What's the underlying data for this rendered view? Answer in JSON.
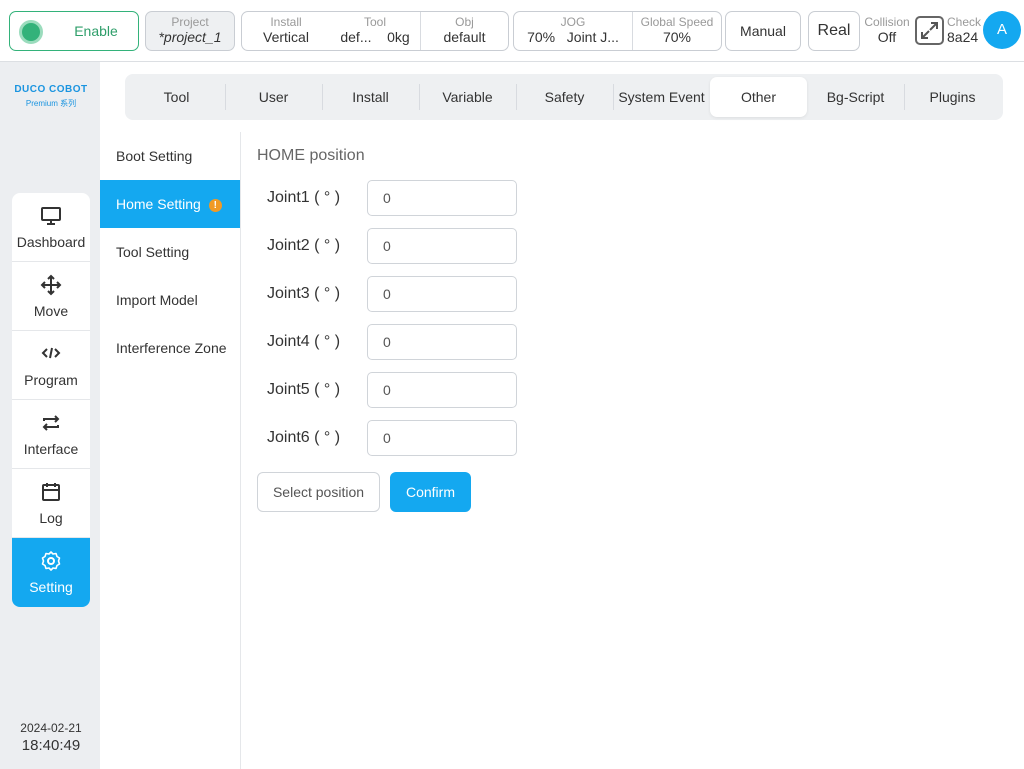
{
  "topbar": {
    "enable_label": "Enable",
    "project": {
      "label": "Project",
      "value": "*project_1"
    },
    "install": {
      "label": "Install",
      "value": "Vertical"
    },
    "tool": {
      "label": "Tool",
      "value_name": "def...",
      "value_load": "0kg"
    },
    "obj": {
      "label": "Obj",
      "value": "default"
    },
    "jog": {
      "label": "JOG",
      "value_speed": "70%",
      "value_mode": "Joint J..."
    },
    "global_speed": {
      "label": "Global Speed",
      "value": "70%"
    },
    "mode_label": "Manual",
    "real_label": "Real",
    "collision": {
      "label": "Collision",
      "value": "Off"
    },
    "check": {
      "label": "Check",
      "value": "8a24"
    },
    "avatar_letter": "A"
  },
  "logo": {
    "line1": "DUCO COBOT",
    "line2": "Premium 系列"
  },
  "nav": [
    {
      "label": "Dashboard",
      "icon": "monitor-icon"
    },
    {
      "label": "Move",
      "icon": "move-arrows-icon"
    },
    {
      "label": "Program",
      "icon": "code-icon"
    },
    {
      "label": "Interface",
      "icon": "swap-icon"
    },
    {
      "label": "Log",
      "icon": "calendar-icon"
    },
    {
      "label": "Setting",
      "icon": "gear-icon",
      "active": true
    }
  ],
  "clock": {
    "date": "2024-02-21",
    "time": "18:40:49"
  },
  "tabs": [
    "Tool",
    "User",
    "Install",
    "Variable",
    "Safety",
    "System Event",
    "Other",
    "Bg-Script",
    "Plugins"
  ],
  "active_tab": "Other",
  "subnav": [
    "Boot Setting",
    "Home Setting",
    "Tool Setting",
    "Import Model",
    "Interference Zone"
  ],
  "active_subnav": "Home Setting",
  "warn_glyph": "!",
  "section_title": "HOME position",
  "joints": [
    {
      "label": "Joint1 ( ° )",
      "value": "0"
    },
    {
      "label": "Joint2 ( ° )",
      "value": "0"
    },
    {
      "label": "Joint3 ( ° )",
      "value": "0"
    },
    {
      "label": "Joint4 ( ° )",
      "value": "0"
    },
    {
      "label": "Joint5 ( ° )",
      "value": "0"
    },
    {
      "label": "Joint6 ( ° )",
      "value": "0"
    }
  ],
  "buttons": {
    "select_position": "Select position",
    "confirm": "Confirm"
  },
  "colors": {
    "accent": "#14a8f0",
    "enable_green": "#33b27a",
    "warning": "#f09a25"
  }
}
